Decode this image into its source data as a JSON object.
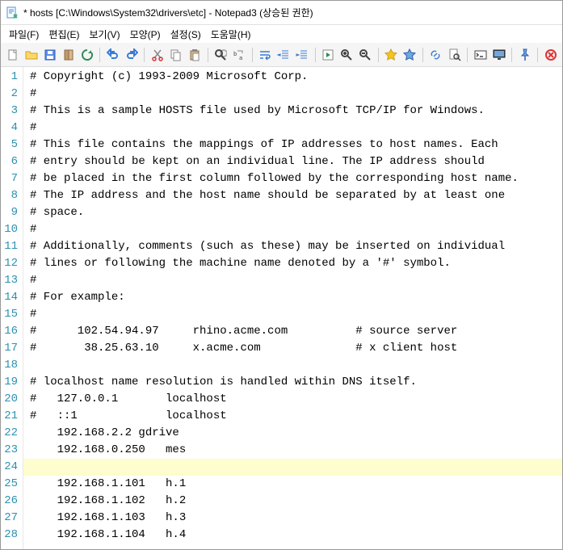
{
  "window": {
    "title": "* hosts [C:\\Windows\\System32\\drivers\\etc] - Notepad3 (상승된 권한)"
  },
  "menu": {
    "items": [
      "파일(F)",
      "편집(E)",
      "보기(V)",
      "모양(P)",
      "설정(S)",
      "도움말(H)"
    ]
  },
  "toolbar": {
    "icons": [
      {
        "name": "new-file-icon",
        "sep": false
      },
      {
        "name": "open-file-icon",
        "sep": false
      },
      {
        "name": "save-icon",
        "sep": false
      },
      {
        "name": "book-icon",
        "sep": false
      },
      {
        "name": "refresh-icon",
        "sep": true
      },
      {
        "name": "undo-icon",
        "sep": false
      },
      {
        "name": "redo-icon",
        "sep": true
      },
      {
        "name": "cut-icon",
        "sep": false
      },
      {
        "name": "copy-icon",
        "sep": false
      },
      {
        "name": "paste-icon",
        "sep": true
      },
      {
        "name": "find-icon",
        "sep": false
      },
      {
        "name": "replace-icon",
        "sep": true
      },
      {
        "name": "word-wrap-icon",
        "sep": false
      },
      {
        "name": "outdent-icon",
        "sep": false
      },
      {
        "name": "indent-icon",
        "sep": true
      },
      {
        "name": "run-icon",
        "sep": false
      },
      {
        "name": "zoom-in-icon",
        "sep": false
      },
      {
        "name": "zoom-out-icon",
        "sep": true
      },
      {
        "name": "star-gold-icon",
        "sep": false
      },
      {
        "name": "star-blue-icon",
        "sep": true
      },
      {
        "name": "link-icon",
        "sep": false
      },
      {
        "name": "search-doc-icon",
        "sep": true
      },
      {
        "name": "terminal-icon",
        "sep": false
      },
      {
        "name": "monitor-icon",
        "sep": true
      },
      {
        "name": "pin-icon",
        "sep": true
      },
      {
        "name": "close-icon",
        "sep": false
      }
    ]
  },
  "editor": {
    "highlight_line": 24,
    "lines": [
      "# Copyright (c) 1993-2009 Microsoft Corp.",
      "#",
      "# This is a sample HOSTS file used by Microsoft TCP/IP for Windows.",
      "#",
      "# This file contains the mappings of IP addresses to host names. Each",
      "# entry should be kept on an individual line. The IP address should",
      "# be placed in the first column followed by the corresponding host name.",
      "# The IP address and the host name should be separated by at least one",
      "# space.",
      "#",
      "# Additionally, comments (such as these) may be inserted on individual",
      "# lines or following the machine name denoted by a '#' symbol.",
      "#",
      "# For example:",
      "#",
      "#      102.54.94.97     rhino.acme.com          # source server",
      "#       38.25.63.10     x.acme.com              # x client host",
      "",
      "# localhost name resolution is handled within DNS itself.",
      "#   127.0.0.1       localhost",
      "#   ::1             localhost",
      "    192.168.2.2 gdrive",
      "    192.168.0.250   mes",
      "    ",
      "    192.168.1.101   h.1",
      "    192.168.1.102   h.2",
      "    192.168.1.103   h.3",
      "    192.168.1.104   h.4"
    ]
  }
}
